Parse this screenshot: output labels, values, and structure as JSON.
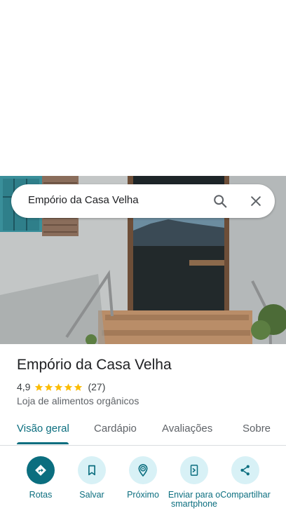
{
  "search": {
    "query": "Empório da Casa Velha",
    "search_icon": "search-icon",
    "close_icon": "close-icon"
  },
  "place": {
    "name": "Empório da Casa Velha",
    "rating": "4,9",
    "stars": 5,
    "reviews": "(27)",
    "category": "Loja de alimentos orgânicos"
  },
  "tabs": [
    {
      "label": "Visão geral",
      "active": true
    },
    {
      "label": "Cardápio",
      "active": false
    },
    {
      "label": "Avaliações",
      "active": false
    },
    {
      "label": "Sobre",
      "active": false
    }
  ],
  "actions": [
    {
      "label": "Rotas",
      "icon": "directions-icon"
    },
    {
      "label": "Salvar",
      "icon": "bookmark-icon"
    },
    {
      "label": "Próximo",
      "icon": "nearby-icon"
    },
    {
      "label": "Enviar para o smartphone",
      "icon": "send-to-phone-icon"
    },
    {
      "label": "Compartilhar",
      "icon": "share-icon"
    }
  ],
  "colors": {
    "accent": "#0b6e7f",
    "action_bg": "#d8f1f6",
    "star": "#fbbc04"
  }
}
